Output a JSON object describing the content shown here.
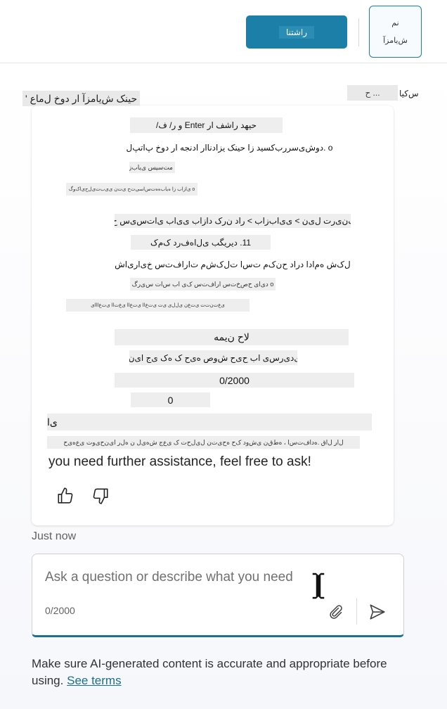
{
  "topbar": {
    "primary_button_label": "راشتنا",
    "tool_button_icon_text": "نم",
    "tool_button_label": "ش‌یامزآ"
  },
  "header": {
    "title": "حینک ش‌یامزآ ار دوخ ل‌ماع '",
    "search_text": "ح ...",
    "lang_text": "س‌کیا"
  },
  "message_lines": [
    {
      "text": "حیهد راشف ار Enter و ر/ ف/"
    },
    {
      "text": "o .دوش‌ی‌سررب‌کسید زا حینک یزادنا‌ار ادنجه ار دوخ پ‌اتپ‌ل"
    },
    {
      "text": "10. مت‌سیس ی‌یاب‌زاب"
    },
    {
      "text": "o ی‌ا‌زاب‌ زا ه‌یاب‌ه‌ه‌ت‌س‌اسی‌ت‌ح ‌ی‌ت‌ن‌ ‌ی‌ی‌ب‌ت‌ی‌ل‌ح‌ی‌ا‌ک‌و‌گ"
    },
    {
      "text": "o ح‌ت‌ک‌ن‌ی‌ر‌ت‌ ل‌ی‌ن‌ > ی‌ی‌ا‌ب‌ز‌ا‌ب > ر‌ا‌د ن‌ر‌ک‌ د‌ا‌ز‌ا‌ب ی‌ی‌ا‌ب‌ ی‌ا‌ت‌س‌ی‌س‌ ح‌ی‌و‌ر‌ب"
    },
    {
      "text": "11. دیریگب ی‌ل‌ا‌ه‌ف‌ر‌د ک‌م‌ک"
    },
    {
      "text": "o ر‌گ‌ا م‌ل‌ک‌ش ه‌م‌ا‌د‌ا د‌ر‌ا‌د ح‌ن‌ک‌م ت‌س‌ا ت‌ل‌ک‌ش‌م ت‌ا‌ر‌ا‌ف‌ت‌س‌ خ‌ی‌ار‌ی‌ا‌ش‌ب‌ا‌ل‌ج‌ی"
    },
    {
      "text": "o د‌ی‌ا‌ی ح‌ص‌خ‌ت‌س‌ ا‌ر‌ا‌ف‌ت‌س‌ ک‌ی ا‌ب س‌ا‌ت‌ ‌س‌ی‌ر‌گ"
    },
    {
      "text": "ی‌ع‌ت‌ن‌ت‌ت‌ ی‌ت‌ع‌ن ی‌ل‌ل‌ی ‌ی‌ت‌ ی‌ت‌ع‌ا‌ا ی‌ت‌ع‌ا‌ا ی‌ع‌ت‌ا‌ا ‌ی‌ت‌ع‌ا‌ا‌ا‌ی"
    },
    {
      "text": "لاح ن‌یمه"
    },
    {
      "text": "ک‌ه ل‌اوس ی‌د‌ی‌ر‌س‌ی ا‌ب ح‌ی‌ح‌ ‌ش‌و‌ص ه‌ی‌ح‌ ک‌ ه‌ک ی‌ج ا‌ی‌ن‌ ب‌ا‌ ر‌ی‌د‌ ار‌د"
    },
    {
      "text": "0/2000"
    },
    {
      "text": "0"
    },
    {
      "text": "ی‌ا"
    },
    {
      "text": "ل‌ا‌ر‌ ل‌ا‌ق‌ .ه‌د‌ا‌ف‌ت‌س‌ا ، ه‌ط‌ق‌ن ی‌ش‌و‌د‌ ک‌ح ه‌ح‌ی‌ت‌ن ل‌ی‌ل‌ح‌ت ک‌ ی‌ع‌ج‌ ش‌ه‌ی‌ل ن‌ ه‌ل‌ر‌ ‌ا‌ی‌ن‌ح‌ی‌و‌ت ی‌ع‌ه‌ی‌ح"
    }
  ],
  "assist_text": "you need further assistance, feel free to ask!",
  "timestamp": "Just now",
  "composer": {
    "placeholder": "Ask a question or describe what you need",
    "counter": "0/2000"
  },
  "disclaimer": {
    "text": "Make sure AI-generated content is accurate and appropriate before using.",
    "link": "See terms"
  },
  "colors": {
    "accent": "#1b7fa8",
    "composer_underline": "#1b6f8f",
    "placeholder_block": "#eeeeee"
  },
  "icons": [
    "thumbs-up-icon",
    "thumbs-down-icon",
    "text-cursor-icon",
    "attach-icon",
    "send-icon"
  ]
}
